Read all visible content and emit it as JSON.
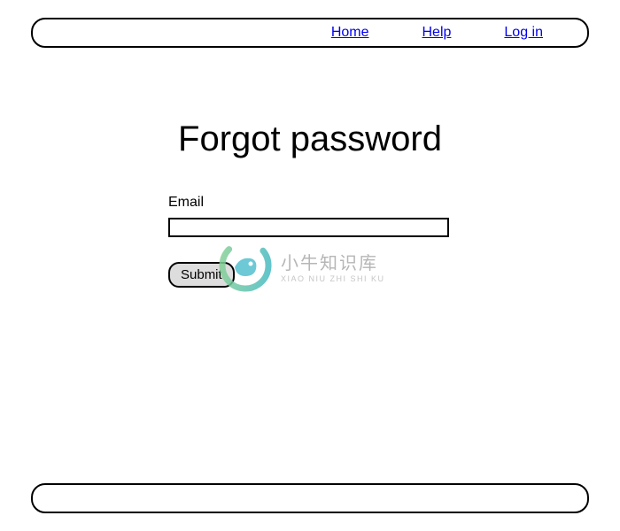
{
  "nav": {
    "home": "Home",
    "help": "Help",
    "login": "Log in"
  },
  "page": {
    "title": "Forgot password"
  },
  "form": {
    "email_label": "Email",
    "email_value": "",
    "submit_label": "Submit"
  },
  "watermark": {
    "cn": "小牛知识库",
    "en": "XIAO NIU ZHI SHI KU"
  }
}
